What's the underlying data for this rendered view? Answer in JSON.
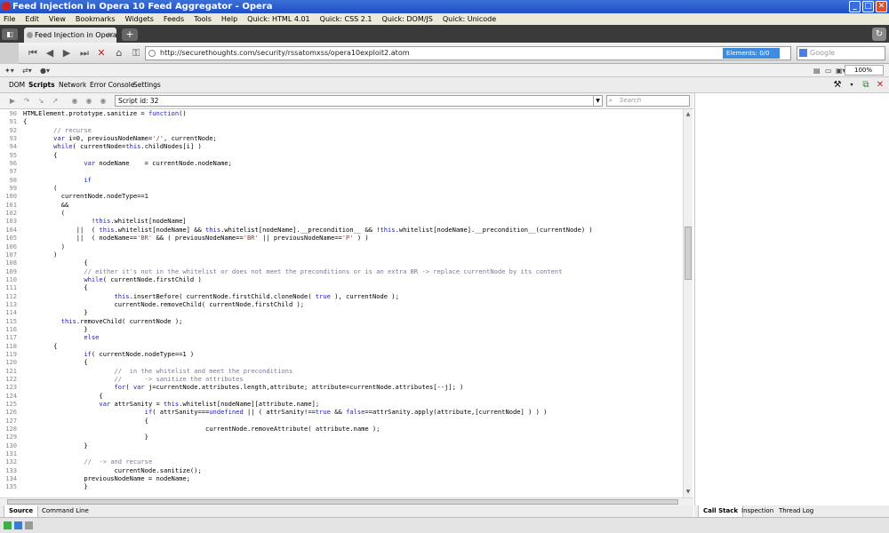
{
  "window": {
    "title": "Feed Injection in Opera 10 Feed Aggregator - Opera"
  },
  "menu": [
    "File",
    "Edit",
    "View",
    "Bookmarks",
    "Widgets",
    "Feeds",
    "Tools",
    "Help",
    "Quick: HTML 4.01",
    "Quick: CSS 2.1",
    "Quick: DOM/JS",
    "Quick: Unicode"
  ],
  "tab": {
    "label": "Feed Injection in Opera ..."
  },
  "address": {
    "url": "http://securethoughts.com/security/rssatomxss/opera10exploit2.atom",
    "elements": "Elements:   0/0"
  },
  "search": {
    "placeholder": "Google"
  },
  "zoom": {
    "value": "100%"
  },
  "devtabs": [
    "DOM",
    "Scripts",
    "Network",
    "Error Console",
    "Settings"
  ],
  "script": {
    "selected": "Script id: 32",
    "search_placeholder": "Search"
  },
  "code_lines": [
    {
      "n": "90",
      "t": "HTMLElement.prototype.sanitize = function()"
    },
    {
      "n": "91",
      "t": "{"
    },
    {
      "n": "92",
      "t": "        // recurse"
    },
    {
      "n": "93",
      "t": "        var i=0, previousNodeName='/', currentNode;"
    },
    {
      "n": "94",
      "t": "        while( currentNode=this.childNodes[i] )"
    },
    {
      "n": "95",
      "t": "        {"
    },
    {
      "n": "96",
      "t": "                var nodeName    = currentNode.nodeName;"
    },
    {
      "n": "97",
      "t": ""
    },
    {
      "n": "98",
      "t": "                if"
    },
    {
      "n": "99",
      "t": "        ("
    },
    {
      "n": "100",
      "t": "          currentNode.nodeType==1"
    },
    {
      "n": "101",
      "t": "          &&"
    },
    {
      "n": "102",
      "t": "          ("
    },
    {
      "n": "103",
      "t": "                  !this.whitelist[nodeName]"
    },
    {
      "n": "104",
      "t": "              ||  ( this.whitelist[nodeName] && this.whitelist[nodeName].__precondition__ && !this.whitelist[nodeName].__precondition__(currentNode) )"
    },
    {
      "n": "105",
      "t": "              ||  ( nodeName=='BR' && ( previousNodeName=='BR' || previousNodeName=='P' ) )"
    },
    {
      "n": "106",
      "t": "          )"
    },
    {
      "n": "107",
      "t": "        )"
    },
    {
      "n": "108",
      "t": "                {"
    },
    {
      "n": "109",
      "t": "                // either it's not in the whitelist or does not meet the preconditions or is an extra BR -> replace currentNode by its content"
    },
    {
      "n": "110",
      "t": "                while( currentNode.firstChild )"
    },
    {
      "n": "111",
      "t": "                {"
    },
    {
      "n": "112",
      "t": "                        this.insertBefore( currentNode.firstChild.cloneNode( true ), currentNode );"
    },
    {
      "n": "113",
      "t": "                        currentNode.removeChild( currentNode.firstChild );"
    },
    {
      "n": "114",
      "t": "                }"
    },
    {
      "n": "115",
      "t": "          this.removeChild( currentNode );"
    },
    {
      "n": "116",
      "t": "                }"
    },
    {
      "n": "117",
      "t": "                else"
    },
    {
      "n": "118",
      "t": "        {"
    },
    {
      "n": "119",
      "t": "                if( currentNode.nodeType==1 )"
    },
    {
      "n": "120",
      "t": "                {"
    },
    {
      "n": "121",
      "t": "                        //  in the whitelist and meet the preconditions"
    },
    {
      "n": "122",
      "t": "                        //      -> sanitize the attributes"
    },
    {
      "n": "123",
      "t": "                        for( var j=currentNode.attributes.length,attribute; attribute=currentNode.attributes[--j]; )"
    },
    {
      "n": "124",
      "t": "                    {"
    },
    {
      "n": "125",
      "t": "                    var attrSanity = this.whitelist[nodeName][attribute.name];"
    },
    {
      "n": "126",
      "t": "                                if( attrSanity===undefined || ( attrSanity!==true && false==attrSanity.apply(attribute,[currentNode] ) ) )"
    },
    {
      "n": "127",
      "t": "                                {"
    },
    {
      "n": "128",
      "t": "                                                currentNode.removeAttribute( attribute.name );"
    },
    {
      "n": "129",
      "t": "                                }"
    },
    {
      "n": "130",
      "t": "                }"
    },
    {
      "n": "131",
      "t": ""
    },
    {
      "n": "132",
      "t": "                //  -> and recurse"
    },
    {
      "n": "133",
      "t": "                        currentNode.sanitize();"
    },
    {
      "n": "134",
      "t": "                previousNodeName = nodeName;"
    },
    {
      "n": "135",
      "t": "                }"
    }
  ],
  "bottom_tabs": [
    "Source",
    "Command Line"
  ],
  "side_tabs": [
    "Call Stack",
    "Inspection",
    "Thread Log"
  ]
}
